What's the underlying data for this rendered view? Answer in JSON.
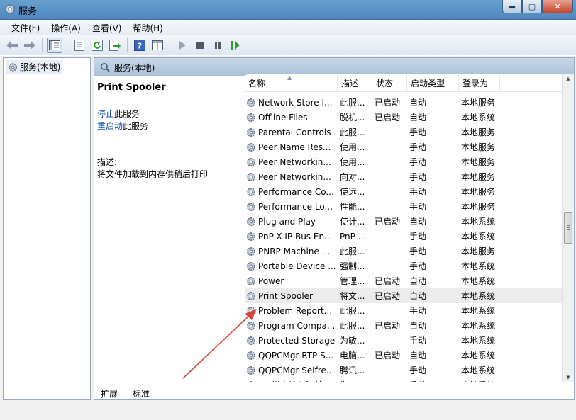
{
  "window": {
    "title": "服务",
    "minimize": "▬",
    "maximize": "▢",
    "close": "✕"
  },
  "menu": [
    "文件(F)",
    "操作(A)",
    "查看(V)",
    "帮助(H)"
  ],
  "tree": {
    "root": "服务(本地)"
  },
  "panel": {
    "header": "服务(本地)",
    "selected_title": "Print Spooler",
    "stop_link": "停止",
    "stop_suffix": "此服务",
    "restart_link": "重启动",
    "restart_suffix": "此服务",
    "desc_label": "描述:",
    "desc_text": "将文件加载到内存供稍后打印"
  },
  "columns": [
    "名称",
    "描述",
    "状态",
    "启动类型",
    "登录为"
  ],
  "rows": [
    {
      "name": "Network Store I...",
      "desc": "此服...",
      "status": "已启动",
      "type": "自动",
      "logon": "本地服务"
    },
    {
      "name": "Offline Files",
      "desc": "脱机...",
      "status": "已启动",
      "type": "自动",
      "logon": "本地系统"
    },
    {
      "name": "Parental Controls",
      "desc": "此服...",
      "status": "",
      "type": "手动",
      "logon": "本地服务"
    },
    {
      "name": "Peer Name Res...",
      "desc": "使用...",
      "status": "",
      "type": "手动",
      "logon": "本地服务"
    },
    {
      "name": "Peer Networkin...",
      "desc": "使用...",
      "status": "",
      "type": "手动",
      "logon": "本地服务"
    },
    {
      "name": "Peer Networkin...",
      "desc": "向对...",
      "status": "",
      "type": "手动",
      "logon": "本地服务"
    },
    {
      "name": "Performance Co...",
      "desc": "使远...",
      "status": "",
      "type": "手动",
      "logon": "本地服务"
    },
    {
      "name": "Performance Lo...",
      "desc": "性能...",
      "status": "",
      "type": "手动",
      "logon": "本地服务"
    },
    {
      "name": "Plug and Play",
      "desc": "使计...",
      "status": "已启动",
      "type": "自动",
      "logon": "本地系统"
    },
    {
      "name": "PnP-X IP Bus En...",
      "desc": "PnP-...",
      "status": "",
      "type": "手动",
      "logon": "本地系统"
    },
    {
      "name": "PNRP Machine ...",
      "desc": "此服...",
      "status": "",
      "type": "手动",
      "logon": "本地服务"
    },
    {
      "name": "Portable Device ...",
      "desc": "强制...",
      "status": "",
      "type": "手动",
      "logon": "本地系统"
    },
    {
      "name": "Power",
      "desc": "管理...",
      "status": "已启动",
      "type": "自动",
      "logon": "本地系统"
    },
    {
      "name": "Print Spooler",
      "desc": "将文...",
      "status": "已启动",
      "type": "自动",
      "logon": "本地系统"
    },
    {
      "name": "Problem Report...",
      "desc": "此服...",
      "status": "",
      "type": "手动",
      "logon": "本地系统"
    },
    {
      "name": "Program Compa...",
      "desc": "此服...",
      "status": "已启动",
      "type": "自动",
      "logon": "本地系统"
    },
    {
      "name": "Protected Storage",
      "desc": "为敏...",
      "status": "",
      "type": "手动",
      "logon": "本地系统"
    },
    {
      "name": "QQPCMgr RTP S...",
      "desc": "电脑...",
      "status": "已启动",
      "type": "自动",
      "logon": "本地系统"
    },
    {
      "name": "QQPCMgr Selfre...",
      "desc": "腾讯...",
      "status": "",
      "type": "手动",
      "logon": "本地系统"
    },
    {
      "name": "QQ拼音输入法基...",
      "desc": "为Q...",
      "status": "",
      "type": "手动",
      "logon": "本地系统"
    }
  ],
  "selected_row_index": 13,
  "tabs": [
    "扩展",
    "标准"
  ],
  "icons": {
    "back": "back-arrow-icon",
    "forward": "forward-arrow-icon",
    "service": "gear-icon",
    "play": "play-icon",
    "stop": "stop-icon",
    "pause": "pause-icon",
    "resume": "resume-icon"
  },
  "colors": {
    "link": "#0b4fb0",
    "annotation_arrow": "#d9473a",
    "titlebar": "#5b8fc6"
  }
}
